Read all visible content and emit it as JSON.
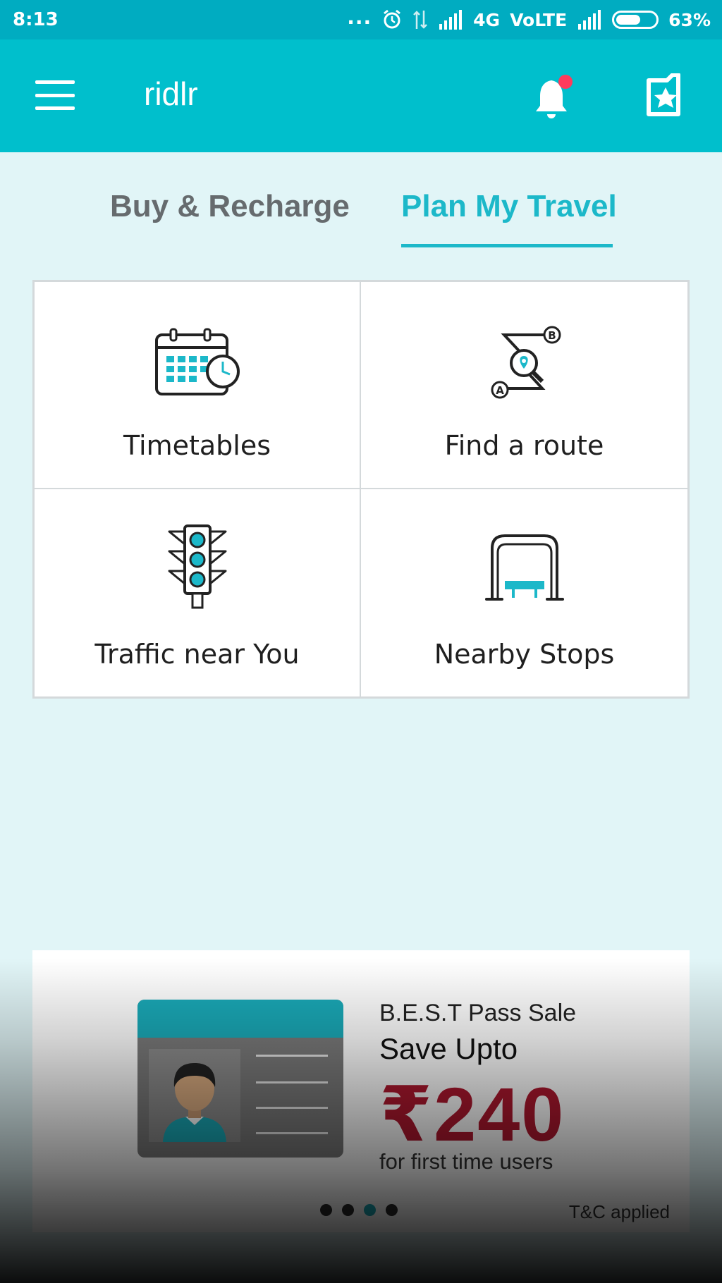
{
  "status_bar": {
    "time": "8:13",
    "dots": "...",
    "network": "4G",
    "volte": "VoLTE",
    "battery": "63%"
  },
  "app_bar": {
    "title": "ridlr",
    "notification_badge_color": "#ff3b5c"
  },
  "tabs": [
    {
      "label": "Buy & Recharge",
      "active": false
    },
    {
      "label": "Plan My Travel",
      "active": true
    }
  ],
  "tiles": [
    {
      "label": "Timetables",
      "icon": "calendar-clock-icon"
    },
    {
      "label": "Find a route",
      "icon": "route-map-icon"
    },
    {
      "label": "Traffic near You",
      "icon": "traffic-light-icon"
    },
    {
      "label": "Nearby Stops",
      "icon": "bus-stop-icon"
    }
  ],
  "banner": {
    "title": "B.E.S.T Pass Sale",
    "save": "Save Upto",
    "amount": "₹240",
    "subtitle": "for first time users",
    "tc": "T&C applied",
    "pages": 4,
    "active_page": 3
  },
  "colors": {
    "primary": "#00bfcc",
    "status_bar": "#00acc1",
    "accent": "#1cb8c9",
    "background": "#e1f5f7",
    "promo_amount": "#b0182f"
  }
}
